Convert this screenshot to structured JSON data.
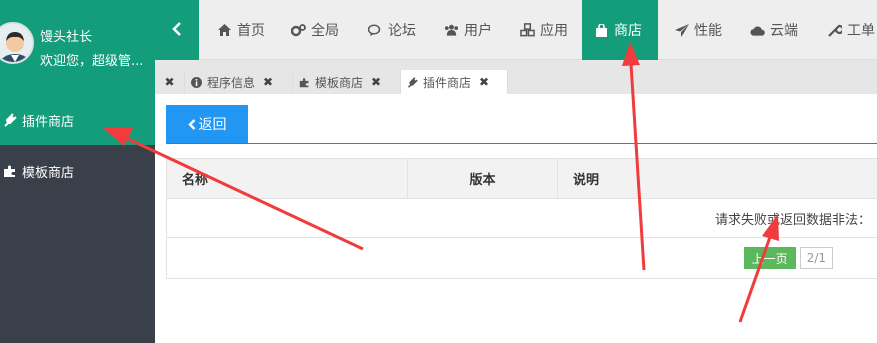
{
  "user": {
    "name": "馒头社长",
    "welcome": "欢迎您，超级管..."
  },
  "sidebar": {
    "items": [
      {
        "label": "插件商店",
        "icon": "plug-icon",
        "active": true
      },
      {
        "label": "模板商店",
        "icon": "puzzle-icon",
        "active": false
      }
    ]
  },
  "topnav": {
    "collapse_icon": "chevron-left-icon",
    "items": [
      {
        "label": "首页",
        "icon": "home-icon"
      },
      {
        "label": "全局",
        "icon": "gears-icon"
      },
      {
        "label": "论坛",
        "icon": "comments-icon"
      },
      {
        "label": "用户",
        "icon": "users-icon"
      },
      {
        "label": "应用",
        "icon": "cubes-icon"
      },
      {
        "label": "商店",
        "icon": "shopping-bag-icon",
        "active": true
      },
      {
        "label": "性能",
        "icon": "paper-plane-icon"
      },
      {
        "label": "云端",
        "icon": "cloud-icon"
      },
      {
        "label": "工单",
        "icon": "wrench-icon"
      }
    ]
  },
  "tabs": [
    {
      "label": "",
      "closable": true
    },
    {
      "label": "程序信息",
      "icon": "info-circle-icon"
    },
    {
      "label": "模板商店",
      "icon": "puzzle-icon"
    },
    {
      "label": "插件商店",
      "icon": "plug-icon",
      "active": true
    }
  ],
  "content": {
    "back_label": "返回",
    "table": {
      "headers": [
        "名称",
        "版本",
        "说明"
      ],
      "message": "请求失败或返回数据非法："
    },
    "pager": {
      "prev_label": "上一页",
      "page_info": "2/1"
    }
  },
  "colors": {
    "accent": "#139d7a",
    "sidebar": "#3a4049",
    "primary": "#2196f3",
    "success": "#5cb85c",
    "annotation": "#f03c3c"
  }
}
